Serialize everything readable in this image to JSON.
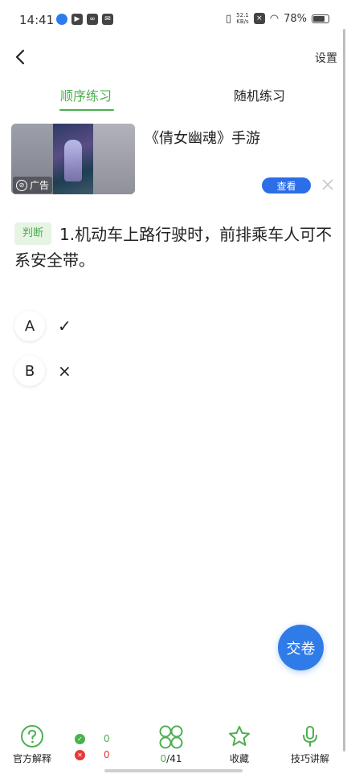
{
  "status_bar": {
    "time": "14:41",
    "net_speed_value": "52.1",
    "net_speed_unit": "KB/s",
    "battery": "78%"
  },
  "header": {
    "back_icon": "chevron-left-icon",
    "settings_label": "设置"
  },
  "tabs": [
    {
      "label": "顺序练习",
      "active": true
    },
    {
      "label": "随机练习",
      "active": false
    }
  ],
  "ad": {
    "badge_label": "广告",
    "title": "《倩女幽魂》手游",
    "view_button": "查看"
  },
  "question": {
    "type_label": "判断",
    "text": "1.机动车上路行驶时，前排乘车人可不系安全带。",
    "options": [
      {
        "letter": "A",
        "symbol": "✓"
      },
      {
        "letter": "B",
        "symbol": "×"
      }
    ]
  },
  "submit_label": "交卷",
  "bottom_bar": {
    "explain_label": "官方解释",
    "correct_count": "0",
    "wrong_count": "0",
    "progress_done": "0",
    "progress_total": "/41",
    "favorite_label": "收藏",
    "tips_label": "技巧讲解"
  },
  "colors": {
    "accent_green": "#4caf50",
    "primary_blue": "#2f7be8",
    "error_red": "#e53935"
  }
}
